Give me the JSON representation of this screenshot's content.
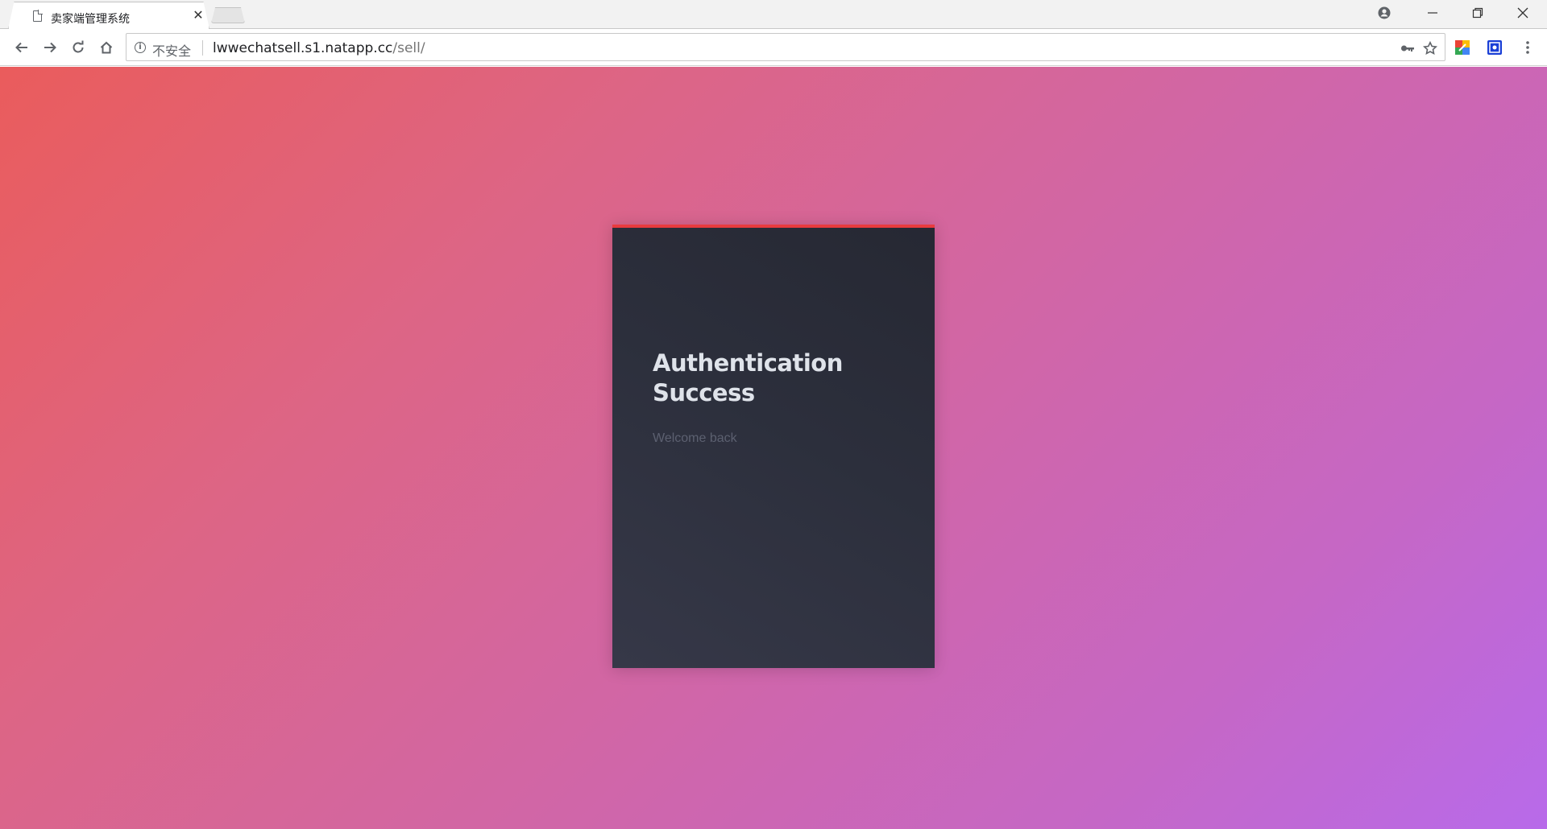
{
  "browser": {
    "tab": {
      "title": "卖家端管理系统",
      "close_symbol": "✕"
    },
    "window_controls": {
      "minimize": "—",
      "restore": "❐",
      "close": "✕"
    },
    "address_bar": {
      "security_label": "不安全",
      "url_host": "lwwechatsell.s1.natapp.cc",
      "url_path": "/sell/"
    },
    "icons": [
      "page-icon",
      "back-arrow-icon",
      "forward-arrow-icon",
      "reload-icon",
      "home-icon",
      "info-icon",
      "key-icon",
      "star-icon",
      "extension-icon",
      "extension-icon-2",
      "menu-dots-icon",
      "profile-icon"
    ]
  },
  "page": {
    "card": {
      "title": "Authentication Success",
      "subtitle": "Welcome back",
      "accent_color": "#e83b3f"
    },
    "background_gradient": [
      "#ea5c5c",
      "#b86aea"
    ]
  }
}
